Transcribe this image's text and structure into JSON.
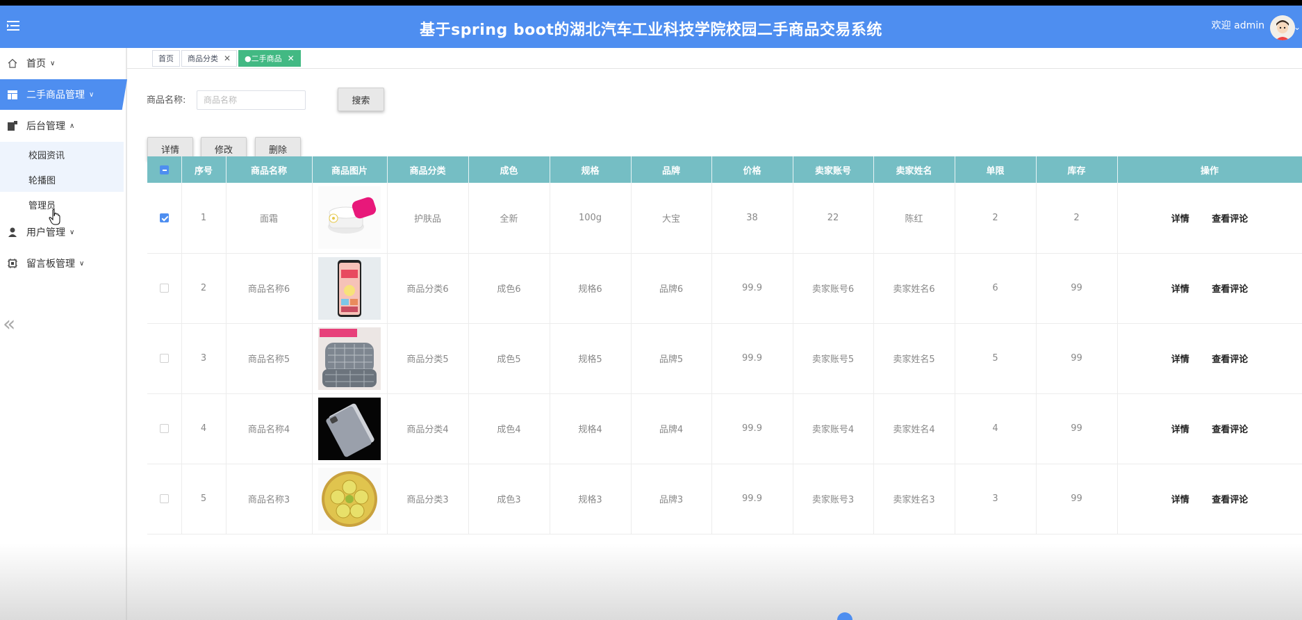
{
  "header": {
    "title": "基于spring boot的湖北汽车工业科技学院校园二手商品交易系统",
    "welcome": "欢迎 admin"
  },
  "sidebar": {
    "items": [
      {
        "label": "首页",
        "icon": "home-icon"
      },
      {
        "label": "二手商品管理",
        "icon": "layout-icon"
      },
      {
        "label": "后台管理",
        "icon": "admin-icon"
      },
      {
        "label": "用户管理",
        "icon": "user-icon"
      },
      {
        "label": "留言板管理",
        "icon": "chip-icon"
      }
    ],
    "sub_items": [
      "校园资讯",
      "轮播图",
      "管理员"
    ]
  },
  "tabs": [
    {
      "label": "首页"
    },
    {
      "label": "商品分类"
    },
    {
      "label": "●二手商品"
    }
  ],
  "search": {
    "label": "商品名称:",
    "placeholder": "商品名称",
    "button": "搜索"
  },
  "actions": {
    "detail": "详情",
    "edit": "修改",
    "delete": "删除"
  },
  "table": {
    "columns": [
      "序号",
      "商品名称",
      "商品图片",
      "商品分类",
      "成色",
      "规格",
      "品牌",
      "价格",
      "卖家账号",
      "卖家姓名",
      "单限",
      "库存",
      "操作"
    ],
    "rows": [
      {
        "no": "1",
        "name": "面霜",
        "image": "cream-image",
        "category": "护肤品",
        "condition": "全新",
        "spec": "100g",
        "brand": "大宝",
        "price": "38",
        "seller_account": "22",
        "seller_name": "陈红",
        "limit": "2",
        "stock": "2",
        "checked": true
      },
      {
        "no": "2",
        "name": "商品名称6",
        "image": "phone-image",
        "category": "商品分类6",
        "condition": "成色6",
        "spec": "规格6",
        "brand": "品牌6",
        "price": "99.9",
        "seller_account": "卖家账号6",
        "seller_name": "卖家姓名6",
        "limit": "6",
        "stock": "99",
        "checked": false
      },
      {
        "no": "3",
        "name": "商品名称5",
        "image": "pillow-image",
        "category": "商品分类5",
        "condition": "成色5",
        "spec": "规格5",
        "brand": "品牌5",
        "price": "99.9",
        "seller_account": "卖家账号5",
        "seller_name": "卖家姓名5",
        "limit": "5",
        "stock": "99",
        "checked": false
      },
      {
        "no": "4",
        "name": "商品名称4",
        "image": "tablet-image",
        "category": "商品分类4",
        "condition": "成色4",
        "spec": "规格4",
        "brand": "品牌4",
        "price": "99.9",
        "seller_account": "卖家账号4",
        "seller_name": "卖家姓名4",
        "limit": "4",
        "stock": "99",
        "checked": false
      },
      {
        "no": "5",
        "name": "商品名称3",
        "image": "fruit-image",
        "category": "商品分类3",
        "condition": "成色3",
        "spec": "规格3",
        "brand": "品牌3",
        "price": "99.9",
        "seller_account": "卖家账号3",
        "seller_name": "卖家姓名3",
        "limit": "3",
        "stock": "99",
        "checked": false
      }
    ],
    "row_ops": {
      "detail": "详情",
      "comments": "查看评论"
    }
  },
  "colors": {
    "header": "#4e8ef0",
    "table_head": "#75bec4",
    "tab_active": "#42b983"
  }
}
